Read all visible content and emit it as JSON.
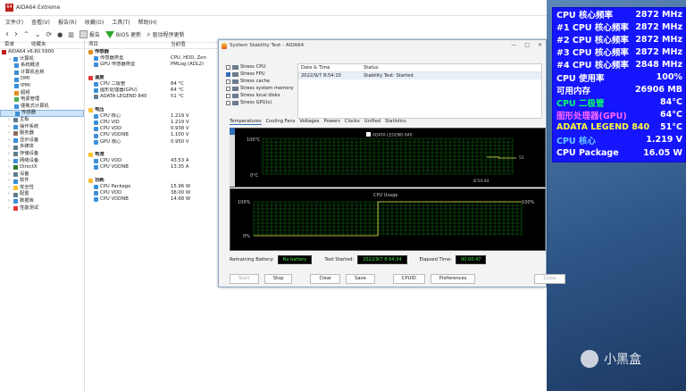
{
  "window": {
    "title": "AIDA64 Extreme"
  },
  "menu": [
    "文件(F)",
    "查看(V)",
    "报告(R)",
    "收藏(O)",
    "工具(T)",
    "帮助(H)"
  ],
  "toolbar": {
    "report": "报告",
    "bios": "BIOS 更新",
    "driver": "驱动程序更新"
  },
  "left_panel": {
    "col1": "菜单",
    "col2": "收藏夹",
    "items": [
      {
        "label": "AIDA64 v6.60.5900",
        "indent": 0,
        "icon": "#c21e1e"
      },
      {
        "label": "计算机",
        "indent": 1,
        "icon": "#3c8fd8",
        "exp": "v"
      },
      {
        "label": "系统概述",
        "indent": 2,
        "icon": "#3c8fd8"
      },
      {
        "label": "计算机名称",
        "indent": 2,
        "icon": "#3c8fd8"
      },
      {
        "label": "DMI",
        "indent": 2,
        "icon": "#3c8fd8"
      },
      {
        "label": "IPMI",
        "indent": 2,
        "icon": "#3c8fd8"
      },
      {
        "label": "超频",
        "indent": 2,
        "icon": "#e58c20"
      },
      {
        "label": "电源管理",
        "indent": 2,
        "icon": "#4caf50"
      },
      {
        "label": "便携式计算机",
        "indent": 2,
        "icon": "#3c8fd8"
      },
      {
        "label": "传感器",
        "indent": 2,
        "icon": "#3c8fd8",
        "selected": true
      },
      {
        "label": "主板",
        "indent": 1,
        "icon": "#607d8b",
        "exp": ">"
      },
      {
        "label": "操作系统",
        "indent": 1,
        "icon": "#3c8fd8",
        "exp": ">"
      },
      {
        "label": "服务器",
        "indent": 1,
        "icon": "#8d6e63",
        "exp": ">"
      },
      {
        "label": "显示设备",
        "indent": 1,
        "icon": "#3c8fd8",
        "exp": ">"
      },
      {
        "label": "多媒体",
        "indent": 1,
        "icon": "#607d8b",
        "exp": ">"
      },
      {
        "label": "存储设备",
        "indent": 1,
        "icon": "#607d8b",
        "exp": ">"
      },
      {
        "label": "网络设备",
        "indent": 1,
        "icon": "#3c8fd8",
        "exp": ">"
      },
      {
        "label": "DirectX",
        "indent": 1,
        "icon": "#2e7d32",
        "exp": ">"
      },
      {
        "label": "设备",
        "indent": 1,
        "icon": "#607d8b",
        "exp": ">"
      },
      {
        "label": "软件",
        "indent": 1,
        "icon": "#3c8fd8",
        "exp": ">"
      },
      {
        "label": "安全性",
        "indent": 1,
        "icon": "#fbc02d",
        "exp": ">"
      },
      {
        "label": "配置",
        "indent": 1,
        "icon": "#607d8b",
        "exp": ">"
      },
      {
        "label": "数据库",
        "indent": 1,
        "icon": "#3c8fd8",
        "exp": ">"
      },
      {
        "label": "性能测试",
        "indent": 1,
        "icon": "#e53935",
        "exp": ">"
      }
    ]
  },
  "mid_panel": {
    "col1": "项目",
    "col2": "当前值",
    "rows": [
      {
        "k": "传感器",
        "v": "",
        "sec": true,
        "icon": "#e58c20"
      },
      {
        "k": "传感器类型",
        "v": "CPU, HDD, Zen",
        "icon": "#3c8fd8"
      },
      {
        "k": "GPU 传感器类型",
        "v": "PMLog (ADL2)",
        "icon": "#3c8fd8"
      },
      {
        "k": "",
        "v": ""
      },
      {
        "k": "温度",
        "v": "",
        "sec": true,
        "icon": "#e53935"
      },
      {
        "k": "CPU 二极管",
        "v": "84 °C",
        "icon": "#3c8fd8"
      },
      {
        "k": "图形处理器(GPU)",
        "v": "64 °C",
        "icon": "#3c8fd8"
      },
      {
        "k": "ADATA LEGEND 840",
        "v": "51 °C",
        "icon": "#607d8b"
      },
      {
        "k": "",
        "v": ""
      },
      {
        "k": "电压",
        "v": "",
        "sec": true,
        "icon": "#fbc02d"
      },
      {
        "k": "CPU 核心",
        "v": "1.219 V",
        "icon": "#3c8fd8"
      },
      {
        "k": "CPU VID",
        "v": "1.219 V",
        "icon": "#3c8fd8"
      },
      {
        "k": "CPU VDD",
        "v": "0.938 V",
        "icon": "#3c8fd8"
      },
      {
        "k": "CPU VDDNB",
        "v": "1.100 V",
        "icon": "#3c8fd8"
      },
      {
        "k": "GPU 核心",
        "v": "0.950 V",
        "icon": "#3c8fd8"
      },
      {
        "k": "",
        "v": ""
      },
      {
        "k": "电流",
        "v": "",
        "sec": true,
        "icon": "#fbc02d"
      },
      {
        "k": "CPU VDD",
        "v": "43.53 A",
        "icon": "#3c8fd8"
      },
      {
        "k": "CPU VDDNB",
        "v": "13.35 A",
        "icon": "#3c8fd8"
      },
      {
        "k": "",
        "v": ""
      },
      {
        "k": "功耗",
        "v": "",
        "sec": true,
        "icon": "#fbc02d"
      },
      {
        "k": "CPU Package",
        "v": "15.96 W",
        "icon": "#3c8fd8"
      },
      {
        "k": "CPU VDD",
        "v": "38.00 W",
        "icon": "#3c8fd8"
      },
      {
        "k": "CPU VDDNB",
        "v": "14.68 W",
        "icon": "#3c8fd8"
      }
    ]
  },
  "dialog": {
    "title": "System Stability Test - AIDA64",
    "stress": [
      {
        "label": "Stress CPU",
        "on": false
      },
      {
        "label": "Stress FPU",
        "on": true
      },
      {
        "label": "Stress cache",
        "on": false
      },
      {
        "label": "Stress system memory",
        "on": false
      },
      {
        "label": "Stress local disks",
        "on": false
      },
      {
        "label": "Stress GPU(s)",
        "on": false
      }
    ],
    "info_headers": [
      "Date & Time",
      "Status"
    ],
    "info_row": [
      "2022/9/7 8:54:15",
      "Stability Test: Started"
    ],
    "tabs": [
      "Temperatures",
      "Cooling Fans",
      "Voltages",
      "Powers",
      "Clocks",
      "Unified",
      "Statistics"
    ],
    "temp_chart": {
      "legend": "ADATA LEGEND 840",
      "ymax": "100°C",
      "ymin": "0°C",
      "time": "8:54:44",
      "value_label": "51"
    },
    "cpu_chart": {
      "title": "CPU Usage",
      "ymax": "100%",
      "ymin": "0%",
      "value_label": "100%"
    },
    "bottom": {
      "battery_label": "Remaining Battery:",
      "battery": "No battery",
      "started_label": "Test Started:",
      "started": "2022/9/7 8:54:34",
      "elapsed_label": "Elapsed Time:",
      "elapsed": "00:00:47"
    },
    "buttons": [
      "Start",
      "Stop",
      "Clear",
      "Save",
      "CPUID",
      "Preferences",
      "Close"
    ]
  },
  "osd": [
    {
      "label": "CPU 核心频率",
      "value": "2872 MHz",
      "color": "#ffffff"
    },
    {
      "label": "#1 CPU 核心频率",
      "value": "2872 MHz",
      "color": "#ffffff"
    },
    {
      "label": "#2 CPU 核心频率",
      "value": "2872 MHz",
      "color": "#ffffff"
    },
    {
      "label": "#3 CPU 核心频率",
      "value": "2872 MHz",
      "color": "#ffffff"
    },
    {
      "label": "#4 CPU 核心频率",
      "value": "2848 MHz",
      "color": "#ffffff"
    },
    {
      "label": "CPU 使用率",
      "value": "100%",
      "color": "#ffffff"
    },
    {
      "label": "可用内存",
      "value": "26906 MB",
      "color": "#ffffff"
    },
    {
      "label": "CPU 二极管",
      "value": "84°C",
      "color": "#00ff66"
    },
    {
      "label": "图形处理器(GPU)",
      "value": "64°C",
      "color": "#ff66ff"
    },
    {
      "label": "ADATA LEGEND 840",
      "value": "51°C",
      "color": "#ffff33"
    },
    {
      "label": "CPU 核心",
      "value": "1.219 V",
      "color": "#66ccff"
    },
    {
      "label": "CPU Package",
      "value": "16.05 W",
      "color": "#ffffff"
    }
  ],
  "watermark": "小黑盒"
}
